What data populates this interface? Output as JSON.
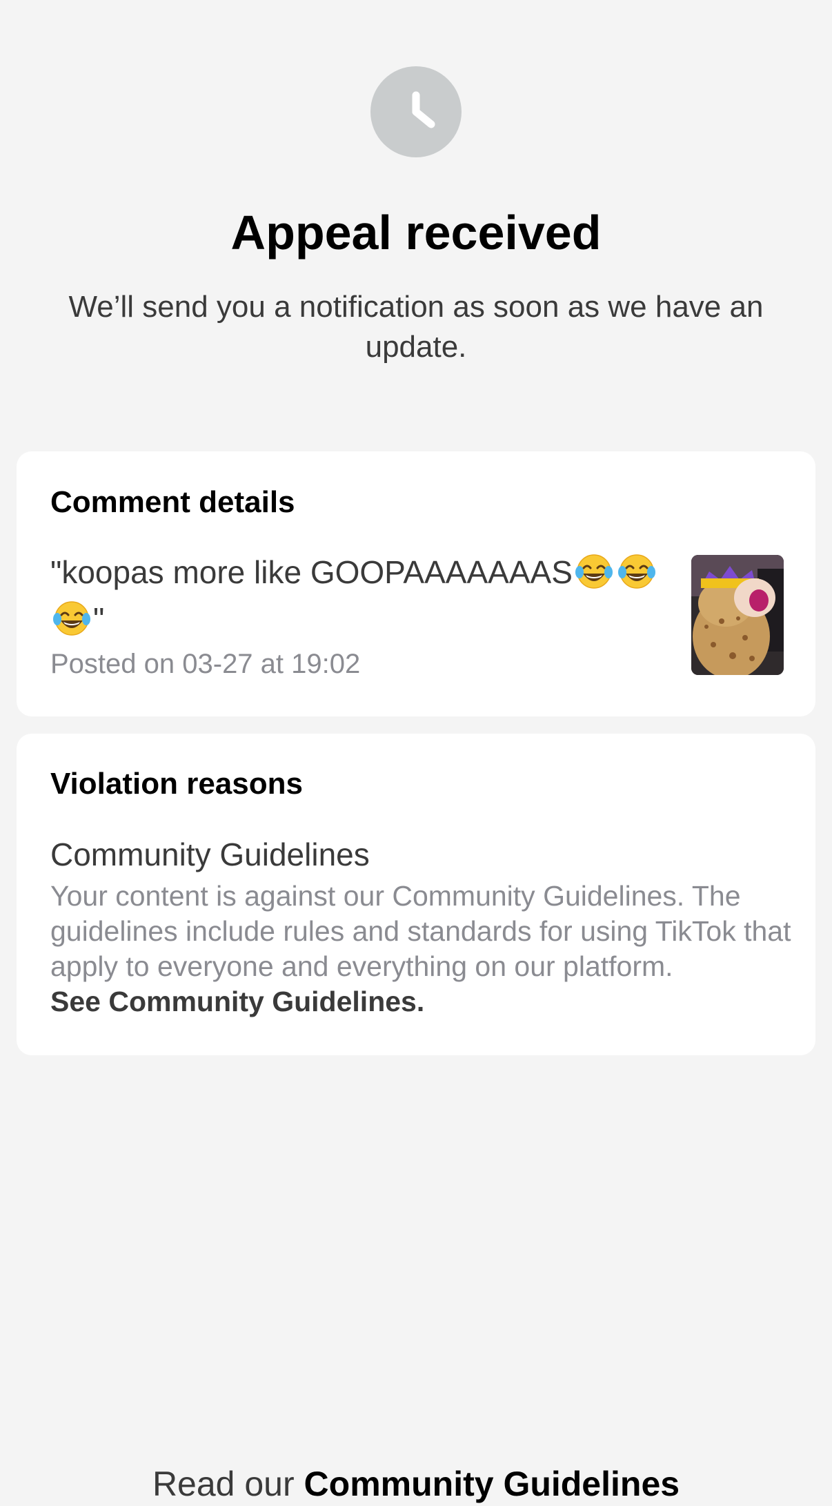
{
  "header": {
    "icon": "clock-icon",
    "title": "Appeal received",
    "subtitle": "We’ll send you a notification as soon as we have an update."
  },
  "comment_card": {
    "title": "Comment details",
    "comment_text": "\"koopas more like GOOPAAAAAAAS",
    "comment_emojis": [
      "face-with-tears-of-joy-icon",
      "face-with-tears-of-joy-icon",
      "face-with-tears-of-joy-icon"
    ],
    "comment_close_quote": "\"",
    "posted": "Posted on 03-27 at 19:02",
    "thumbnail": "video-thumbnail"
  },
  "violation_card": {
    "title": "Violation reasons",
    "section_heading": "Community Guidelines",
    "body": "Your content is against our Community Guidelines. The guidelines include rules and standards for using TikTok that apply to everyone and everything on our platform.",
    "link": "See Community Guidelines."
  },
  "footer": {
    "prefix": "Read our",
    "link": "Community Guidelines"
  },
  "colors": {
    "background": "#f4f4f4",
    "card": "#ffffff",
    "icon_circle": "#c9cccd",
    "muted_text": "#8a8b91"
  }
}
